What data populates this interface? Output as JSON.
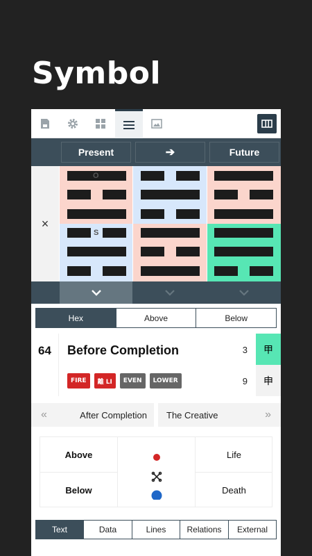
{
  "headline": "Symbol",
  "toolbar": {
    "icons": [
      "save-icon",
      "gear-icon",
      "grid-icon",
      "menu-icon",
      "image-icon"
    ],
    "active": "menu-icon",
    "right_icon": "columns-icon"
  },
  "header": {
    "present": "Present",
    "arrow": "➔",
    "future": "Future"
  },
  "grid": {
    "close_label": "×",
    "top_tag": "O",
    "bottom_tag": "S",
    "colors": {
      "pink": "#fbd5cc",
      "blue": "#d7e7fb",
      "green": "#57e6b4",
      "dark": "#1c1c1c"
    }
  },
  "tabs": [
    "Hex",
    "Above",
    "Below"
  ],
  "hexagram": {
    "number": "64",
    "name": "Before Completion",
    "top_count": "3",
    "bottom_count": "9",
    "top_char": "甲",
    "bottom_char": "申",
    "badges": [
      {
        "label": "FIRE",
        "color": "#d32626"
      },
      {
        "label": "離 LI",
        "color": "#d32626"
      },
      {
        "label": "EVEN",
        "color": "#666666"
      },
      {
        "label": "LOWER",
        "color": "#666666"
      }
    ]
  },
  "nav": {
    "prev_label": "After Completion",
    "next_label": "The Creative",
    "prev_icon": "«",
    "next_icon": "»"
  },
  "relations": {
    "above": "Above",
    "below": "Below",
    "life": "Life",
    "death": "Death"
  },
  "bottom_tabs": [
    "Text",
    "Data",
    "Lines",
    "Relations",
    "External"
  ]
}
